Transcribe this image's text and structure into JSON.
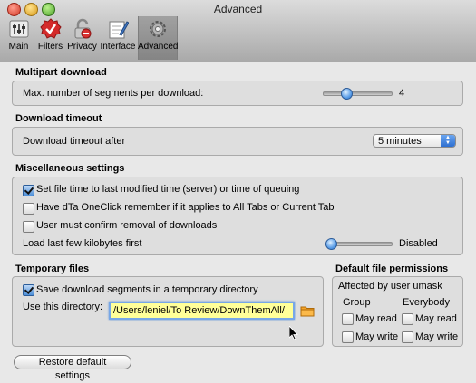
{
  "window": {
    "title": "Advanced"
  },
  "toolbar": {
    "items": [
      {
        "label": "Main",
        "icon": "main-sliders-icon"
      },
      {
        "label": "Filters",
        "icon": "filters-check-icon"
      },
      {
        "label": "Privacy",
        "icon": "privacy-lock-icon"
      },
      {
        "label": "Interface",
        "icon": "interface-pencil-icon"
      },
      {
        "label": "Advanced",
        "icon": "advanced-gear-icon",
        "selected": true
      }
    ]
  },
  "multipart": {
    "title": "Multipart download",
    "label": "Max. number of segments per download:",
    "value": "4",
    "slider_fraction": 0.35
  },
  "timeout": {
    "title": "Download timeout",
    "label": "Download timeout after",
    "selected": "5 minutes"
  },
  "misc": {
    "title": "Miscellaneous settings",
    "options": [
      {
        "label": "Set file time to last modified time (server) or time of queuing",
        "checked": true
      },
      {
        "label": "Have dTa OneClick remember if it applies to All Tabs or Current Tab",
        "checked": false
      },
      {
        "label": "User must confirm removal of downloads",
        "checked": false
      }
    ],
    "load_label": "Load last few kilobytes first",
    "load_value": "Disabled",
    "load_fraction": 0.0
  },
  "temp": {
    "title": "Temporary files",
    "save_label": "Save download segments in a temporary directory",
    "save_checked": true,
    "dir_label": "Use this directory:",
    "dir_value": "/Users/leniel/To Review/DownThemAll/"
  },
  "perm": {
    "title": "Default file permissions",
    "subtitle": "Affected by user umask",
    "group_header": "Group",
    "everybody_header": "Everybody",
    "read_label": "May read",
    "write_label": "May write"
  },
  "restore_label": "Restore default settings"
}
